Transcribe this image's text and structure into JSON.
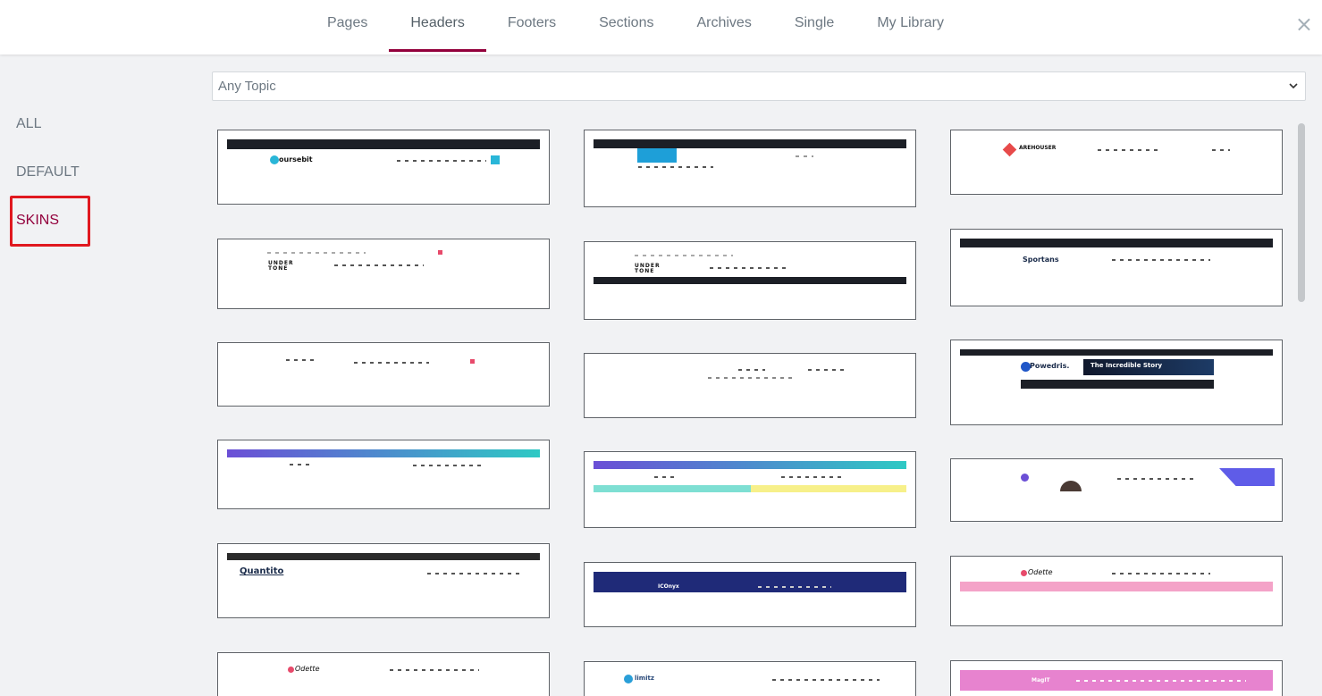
{
  "tabs": [
    {
      "label": "Pages"
    },
    {
      "label": "Headers",
      "active": true
    },
    {
      "label": "Footers"
    },
    {
      "label": "Sections"
    },
    {
      "label": "Archives"
    },
    {
      "label": "Single"
    },
    {
      "label": "My Library"
    }
  ],
  "close_icon": "×",
  "sidebar": {
    "items": [
      {
        "label": "ALL"
      },
      {
        "label": "DEFAULT"
      },
      {
        "label": "SKINS",
        "selected": true
      }
    ]
  },
  "filter": {
    "selected": "Any Topic"
  },
  "colors": {
    "accent": "#93003c",
    "highlight": "#e0181f",
    "thumb_border": "#5f6368"
  },
  "thumbnails": {
    "coursebit": "oursebit",
    "warehouse": "AREHOUSER",
    "undertone_a": "UNDER TONE",
    "undertone_b": "UNDER TONE",
    "sportans": "Sportans",
    "powedris": "Powedris.",
    "incredible": "The Incredible Story",
    "quantito": "Quantito",
    "iconyx": "ICOnyx",
    "odette_a": "Odette",
    "odette_b": "Odette",
    "limitz": "limitz",
    "magit": "MagIT"
  }
}
